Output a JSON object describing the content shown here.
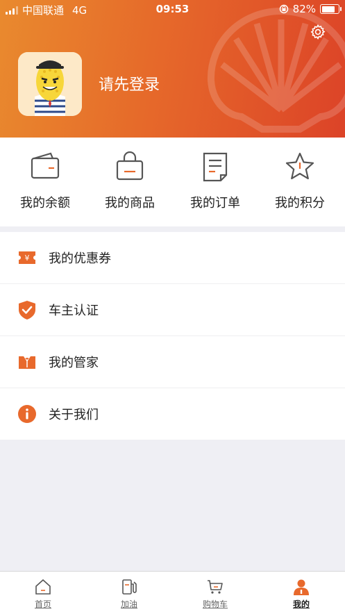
{
  "status_bar": {
    "carrier": "中国联通",
    "network": "4G",
    "time": "09:53",
    "battery": "82%",
    "battery_level": 0.82
  },
  "header": {
    "login_prompt": "请先登录"
  },
  "quick_actions": [
    {
      "label": "我的余额",
      "icon": "wallet-icon"
    },
    {
      "label": "我的商品",
      "icon": "shopping-bag-icon"
    },
    {
      "label": "我的订单",
      "icon": "order-document-icon"
    },
    {
      "label": "我的积分",
      "icon": "star-icon"
    }
  ],
  "menu": [
    {
      "label": "我的优惠券",
      "icon": "coupon-icon"
    },
    {
      "label": "车主认证",
      "icon": "shield-check-icon"
    },
    {
      "label": "我的管家",
      "icon": "butler-icon"
    },
    {
      "label": "关于我们",
      "icon": "info-icon"
    }
  ],
  "tabs": [
    {
      "label": "首页",
      "icon": "home-icon"
    },
    {
      "label": "加油",
      "icon": "fuel-pump-icon"
    },
    {
      "label": "购物车",
      "icon": "cart-icon"
    },
    {
      "label": "我的",
      "icon": "profile-icon",
      "active": true
    }
  ],
  "colors": {
    "accent": "#e8692c",
    "accent_dark": "#dc4328"
  }
}
